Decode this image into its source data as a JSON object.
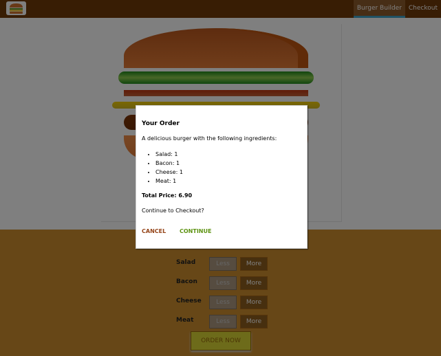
{
  "nav": {
    "items": [
      {
        "label": "Burger Builder",
        "active": true
      },
      {
        "label": "Checkout",
        "active": false
      }
    ]
  },
  "logo": {
    "icon": "burger-logo-icon"
  },
  "controls": {
    "items": [
      {
        "label": "Salad",
        "less": "Less",
        "more": "More"
      },
      {
        "label": "Bacon",
        "less": "Less",
        "more": "More"
      },
      {
        "label": "Cheese",
        "less": "Less",
        "more": "More"
      },
      {
        "label": "Meat",
        "less": "Less",
        "more": "More"
      }
    ],
    "order_label": "ORDER NOW"
  },
  "modal": {
    "title": "Your Order",
    "description": "A delicious burger with the following ingredients:",
    "ingredients": [
      "Salad: 1",
      "Bacon: 1",
      "Cheese: 1",
      "Meat: 1"
    ],
    "total_price": "Total Price: 6.90",
    "question": "Continue to Checkout?",
    "cancel_label": "CANCEL",
    "continue_label": "CONTINUE"
  },
  "colors": {
    "toolbar": "#703b09",
    "controls_background": "#cf8f2e",
    "active_tab_underline": "#40a4c8",
    "cancel": "#944317",
    "continue": "#5c9210"
  }
}
